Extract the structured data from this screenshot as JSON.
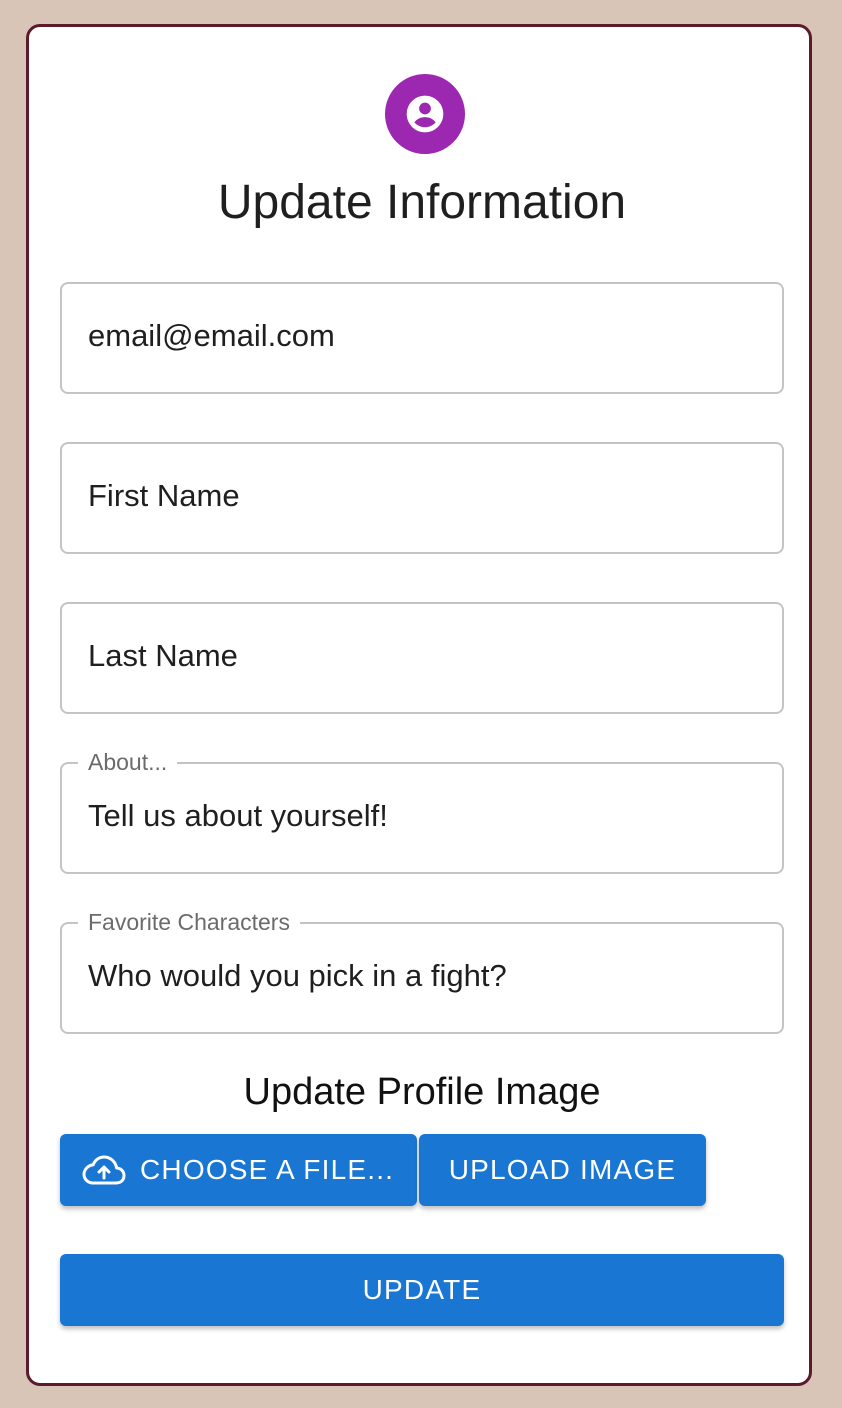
{
  "form": {
    "title": "Update Information",
    "avatar_icon": "account-circle-icon",
    "accent_color": "#9c27b0",
    "fields": {
      "email": {
        "value": "email@email.com"
      },
      "first_name": {
        "placeholder": "First Name"
      },
      "last_name": {
        "placeholder": "Last Name"
      },
      "about": {
        "label": "About...",
        "placeholder": "Tell us about yourself!"
      },
      "favorite_characters": {
        "label": "Favorite Characters",
        "placeholder": "Who would you pick in a fight?"
      }
    },
    "profile_image": {
      "heading": "Update Profile Image",
      "choose_label": "Choose a file...",
      "choose_icon": "cloud-upload-icon",
      "upload_label": "Upload Image"
    },
    "update_label": "Update",
    "button_color": "#1976d2"
  }
}
